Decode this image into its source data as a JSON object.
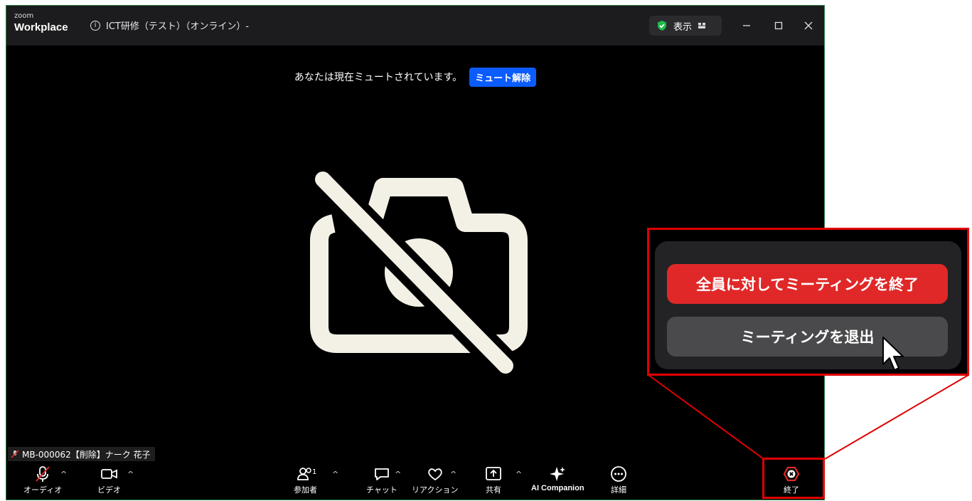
{
  "app": {
    "logo_small": "zoom",
    "logo_large": "Workplace",
    "meeting_title": "ICT研修（テスト）（オンライン）-",
    "view_label": "表示",
    "info_icon": "info-icon",
    "colors": {
      "accent": "#0b5cff",
      "danger": "#e02828",
      "highlight": "#e00000"
    }
  },
  "banner": {
    "text": "あなたは現在ミュートされています。",
    "unmute_label": "ミュート解除"
  },
  "participant": {
    "name": "MB-000062【削除】ナーク 花子"
  },
  "toolbar": {
    "audio": "オーディオ",
    "video": "ビデオ",
    "participants": "参加者",
    "participants_count": "1",
    "chat": "チャット",
    "reactions": "リアクション",
    "share": "共有",
    "ai": "AI Companion",
    "more": "詳細",
    "end": "終了"
  },
  "end_menu": {
    "end_for_all": "全員に対してミーティングを終了",
    "leave": "ミーティングを退出"
  }
}
